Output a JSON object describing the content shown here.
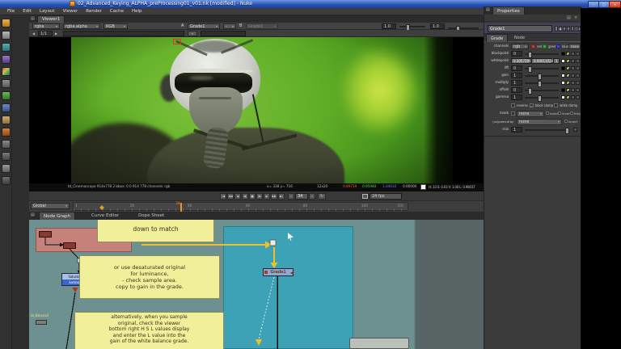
{
  "window": {
    "title": "02_Advanced_Keying_ALPHA_preProcessing01_v01.nk [modified] - Nuke",
    "minimize": "–",
    "maximize": "▢",
    "close": "×"
  },
  "menu": {
    "items": [
      "File",
      "Edit",
      "Layout",
      "Viewer",
      "Render",
      "Cache",
      "Help"
    ]
  },
  "toolbar_icons": [
    "image",
    "draw",
    "time",
    "channel",
    "color",
    "filter",
    "keyer",
    "merge",
    "transform",
    "3d",
    "particles",
    "deep",
    "views",
    "other"
  ],
  "ui": {
    "caret": "▾",
    "check": "✓",
    "panel_menu": "▤"
  },
  "viewer": {
    "tab": "Viewer1",
    "layer_select": "rgba",
    "alpha_select": "rgba.alpha",
    "display_select": "RGB",
    "a_label": "A",
    "a_input": "Grade1",
    "wipe_select": "-",
    "b_label": "B",
    "b_input": "Grade1",
    "gain_value": "1.0",
    "gamma_value": "1.0",
    "proxy_prev": "◀",
    "proxy_value": "1/1",
    "proxy_next": "▶",
    "info": {
      "format": "bt_Cinemascope 914x778 2 bbox: 0 0 914 778 channels: rgb",
      "xy": "x= 338 y= 716",
      "sample": "12x20",
      "r": "0.89719",
      "g": "0.95940",
      "b": "1.04610",
      "a": "0.00000",
      "hsvl": "H: 33 S: 0.03 V: 1.00  L: 0.98037"
    },
    "transport": {
      "glyphs": [
        "|◀",
        "◀◀",
        "◀",
        "◀|",
        "■",
        "|▶",
        "▶",
        "▶▶",
        "▶|"
      ],
      "frame_dec": "«",
      "frame": "34",
      "frame_inc": "»",
      "loop": "↻",
      "fps": "24 fps"
    },
    "timeline": {
      "range_mode": "Global",
      "start": "1",
      "end": "116",
      "playhead": "34",
      "ticks": [
        "20",
        "40",
        "60",
        "80",
        "100"
      ]
    }
  },
  "nodegraph": {
    "tabs": [
      "Node Graph",
      "Curve Editor",
      "Dope Sheet"
    ],
    "note_top": "down to match",
    "note_mid": "or  use desaturated original\nfor luminance,\n- check sample area.\ncopy to gain in the grade.",
    "note_bottom": "alternatively, when you sample\noriginal, check the viewer\nbottom right H S L values display\nand enter the L value into the\ngain of the white balance grade.",
    "saturation_node": {
      "name": "Saturation2",
      "label": "luminance"
    },
    "grade_node": "Grade1",
    "balance_label": "bt_Balance2"
  },
  "properties": {
    "tab": "Properties",
    "panel_icons": [
      "▤",
      "×"
    ],
    "node_name": "Grade1",
    "header_buttons": [
      "▣",
      "↩",
      "↪",
      "?",
      "▢",
      "×"
    ],
    "tabs": [
      "Grade",
      "Node"
    ],
    "channels_label": "channels",
    "channels_value": "rgb",
    "channel_red": "red",
    "channel_green": "green",
    "channel_blue": "blue",
    "channels_extra": "none",
    "blackpoint": {
      "label": "blackpoint",
      "value": "0"
    },
    "whitepoint": {
      "label": "whitepoint",
      "v1": "0.3057296",
      "v2": "0.94011028",
      "v3": "1"
    },
    "lift": {
      "label": "lift",
      "value": "0"
    },
    "gain": {
      "label": "gain",
      "value": "1"
    },
    "multiply": {
      "label": "multiply",
      "value": "1"
    },
    "offset": {
      "label": "offset",
      "value": "0"
    },
    "gamma": {
      "label": "gamma",
      "value": "1"
    },
    "reverse": "reverse",
    "black_clamp": "black clamp",
    "white_clamp": "white clamp",
    "mask_label": "mask",
    "mask_value": "none",
    "inject": "inject",
    "invert": "invert",
    "fringe": "fringe",
    "unpremult_label": "(un)premult by",
    "unpremult_value": "none",
    "unpremult_invert": "invert",
    "mix": {
      "label": "mix",
      "value": "1"
    },
    "colors": {
      "accent_orange": "#ff8c1a",
      "note_yellow": "#f2ef9b",
      "backdrop_salmon": "#c4827a",
      "backdrop_cyan": "#3ea2b6",
      "selected_node_blue": "#8aa8d8",
      "green_screen": "#69b32a"
    }
  }
}
